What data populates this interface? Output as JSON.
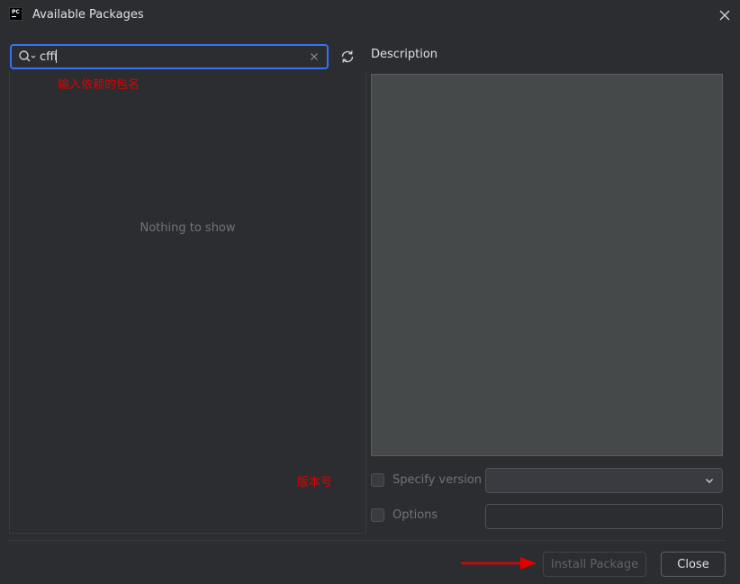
{
  "window": {
    "title": "Available Packages",
    "icon_text": "PC"
  },
  "search": {
    "value": "cffi"
  },
  "package_list": {
    "empty_text": "Nothing to show",
    "annotation_package": "输入依赖的包名",
    "annotation_version": "版本号"
  },
  "description": {
    "label": "Description"
  },
  "options": {
    "specify_version_label": "Specify version",
    "specify_version_checked": false,
    "options_label": "Options",
    "options_checked": false
  },
  "buttons": {
    "install_label": "Install Package",
    "close_label": "Close"
  },
  "colors": {
    "background": "#2b2d30",
    "accent_focus": "#3574f0",
    "description_bg": "#45494a",
    "annotation_red": "#e00000"
  }
}
